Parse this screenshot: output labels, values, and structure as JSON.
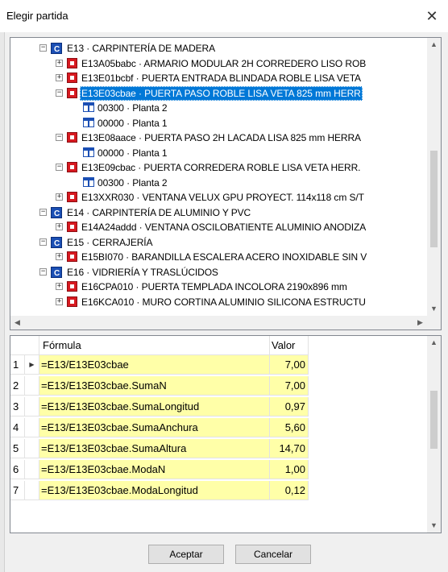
{
  "window": {
    "title": "Elegir partida",
    "close_glyph": "✕"
  },
  "tree": {
    "nodes": [
      {
        "id": "n0",
        "kind": "chapter",
        "expander": "−",
        "label": "E13 · CARPINTERÍA DE MADERA"
      },
      {
        "id": "n1",
        "kind": "item",
        "expander": "+",
        "label": "E13A05babc · ARMARIO MODULAR 2H CORREDERO LISO ROB"
      },
      {
        "id": "n2",
        "kind": "item",
        "expander": "+",
        "label": "E13E01bcbf · PUERTA ENTRADA BLINDADA ROBLE LISA VETA"
      },
      {
        "id": "n3",
        "kind": "item",
        "expander": "−",
        "label": "E13E03cbae · PUERTA PASO  ROBLE LISA VETA 825 mm HERR",
        "selected": true
      },
      {
        "id": "n4",
        "kind": "medicion",
        "expander": "",
        "label": "00300 · Planta 2"
      },
      {
        "id": "n5",
        "kind": "medicion",
        "expander": "",
        "label": "00000 · Planta 1"
      },
      {
        "id": "n6",
        "kind": "item",
        "expander": "−",
        "label": "E13E08aace · PUERTA PASO 2H  LACADA LISA 825 mm HERRA"
      },
      {
        "id": "n7",
        "kind": "medicion",
        "expander": "",
        "label": "00000 · Planta 1"
      },
      {
        "id": "n8",
        "kind": "item",
        "expander": "−",
        "label": "E13E09cbac · PUERTA CORREDERA  ROBLE LISA VETA HERR."
      },
      {
        "id": "n9",
        "kind": "medicion",
        "expander": "",
        "label": "00300 · Planta 2"
      },
      {
        "id": "n10",
        "kind": "item",
        "expander": "+",
        "label": "E13XXR030 · VENTANA VELUX GPU PROYECT. 114x118 cm S/T"
      },
      {
        "id": "n11",
        "kind": "chapter",
        "expander": "−",
        "label": "E14 · CARPINTERÍA DE ALUMINIO Y PVC"
      },
      {
        "id": "n12",
        "kind": "item",
        "expander": "+",
        "label": "E14A24addd · VENTANA OSCILOBATIENTE ALUMINIO ANODIZA"
      },
      {
        "id": "n13",
        "kind": "chapter",
        "expander": "−",
        "label": "E15 · CERRAJERÍA"
      },
      {
        "id": "n14",
        "kind": "item",
        "expander": "+",
        "label": "E15BI070 · BARANDILLA ESCALERA ACERO INOXIDABLE SIN V"
      },
      {
        "id": "n15",
        "kind": "chapter",
        "expander": "−",
        "label": "E16 · VIDRIERÍA Y TRASLÚCIDOS"
      },
      {
        "id": "n16",
        "kind": "item",
        "expander": "+",
        "label": "E16CPA010 · PUERTA TEMPLADA INCOLORA 2190x896 mm"
      },
      {
        "id": "n17",
        "kind": "item",
        "expander": "+",
        "label": "E16KCA010 · MURO CORTINA ALUMINIO SILICONA ESTRUCTU"
      }
    ]
  },
  "grid": {
    "headers": {
      "formula": "Fórmula",
      "value": "Valor"
    },
    "rows": [
      {
        "num": "1",
        "current": true,
        "formula": "=E13/E13E03cbae",
        "value": "7,00"
      },
      {
        "num": "2",
        "current": false,
        "formula": "=E13/E13E03cbae.SumaN",
        "value": "7,00"
      },
      {
        "num": "3",
        "current": false,
        "formula": "=E13/E13E03cbae.SumaLongitud",
        "value": "0,97"
      },
      {
        "num": "4",
        "current": false,
        "formula": "=E13/E13E03cbae.SumaAnchura",
        "value": "5,60"
      },
      {
        "num": "5",
        "current": false,
        "formula": "=E13/E13E03cbae.SumaAltura",
        "value": "14,70"
      },
      {
        "num": "6",
        "current": false,
        "formula": "=E13/E13E03cbae.ModaN",
        "value": "1,00"
      },
      {
        "num": "7",
        "current": false,
        "formula": "=E13/E13E03cbae.ModaLongitud",
        "value": "0,12"
      }
    ]
  },
  "buttons": {
    "accept": "Aceptar",
    "cancel": "Cancelar"
  },
  "colors": {
    "selection": "#0078d7",
    "formula_bg": "#ffffa8",
    "chapter_icon": "#1b4fb4",
    "item_icon": "#d71920"
  }
}
